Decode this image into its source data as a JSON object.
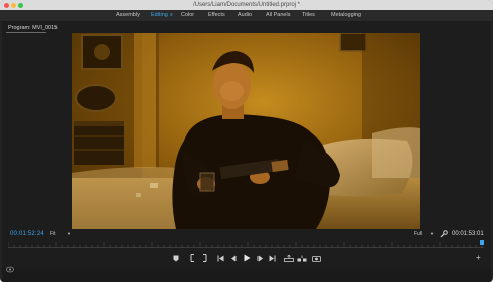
{
  "window": {
    "title": "/Users/Liam/Documents/Untitled.prproj *"
  },
  "workspaces": {
    "tabs": [
      "Assembly",
      "Editing",
      "Color",
      "Effects",
      "Audio",
      "All Panels",
      "Titles",
      "Metalogging"
    ],
    "active": "Editing",
    "menu_glyph": "≡"
  },
  "program_monitor": {
    "title": "Program: MVI_0015",
    "menu_glyph": "≡",
    "timecode_current": "00:01:52:24",
    "zoom": "Fit",
    "resolution": "Full",
    "timecode_duration": "00:01:53:01",
    "playhead_fraction": 0.995
  },
  "transport": {
    "buttons": [
      "marker",
      "mark-in",
      "mark-out",
      "go-to-in",
      "step-back",
      "play",
      "step-forward",
      "go-to-out",
      "lift",
      "extract",
      "export-frame"
    ],
    "add_glyph": "+"
  },
  "colors": {
    "accent": "#3ea6e8",
    "panel_bg": "#1d1d1d"
  }
}
